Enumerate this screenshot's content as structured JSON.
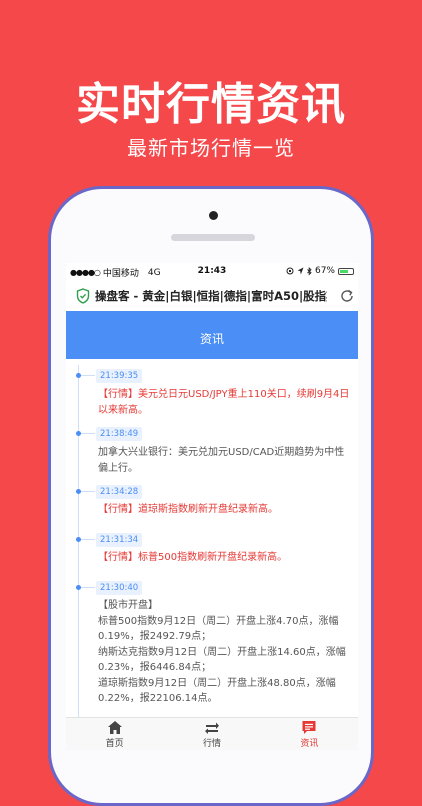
{
  "headline": "实时行情资讯",
  "subhead": "最新市场行情一览",
  "status_bar": {
    "signal": "●●●●○",
    "carrier": "中国移动",
    "network": "4G",
    "time": "21:43",
    "battery_percent": "67%",
    "battery_level": 0.67
  },
  "url_bar": {
    "title": "操盘客 - 黄金|白银|恒指|德指|富时A50|股指期..."
  },
  "banner": {
    "title": "资讯"
  },
  "feed": [
    {
      "time": "21:39:35",
      "text": "【行情】美元兑日元USD/JPY重上110关口，续刷9月4日以来新高。",
      "highlight": true
    },
    {
      "time": "21:38:49",
      "text": "加拿大兴业银行：美元兑加元USD/CAD近期趋势为中性偏上行。",
      "highlight": false
    },
    {
      "time": "21:34:28",
      "text": "【行情】道琼斯指数刷新开盘纪录新高。",
      "highlight": true
    },
    {
      "time": "21:31:34",
      "text": "【行情】标普500指数刷新开盘纪录新高。",
      "highlight": true
    },
    {
      "time": "21:30:40",
      "text": "【股市开盘】\n标普500指数9月12日（周二）开盘上涨4.70点，涨幅0.19%，报2492.79点；\n纳斯达克指数9月12日（周二）开盘上涨14.60点，涨幅0.23%，报6446.84点；\n道琼斯指数9月12日（周二）开盘上涨48.80点，涨幅0.22%，报22106.14点。",
      "highlight": false
    }
  ],
  "tabs": [
    {
      "label": "首页",
      "icon": "home-icon",
      "active": false
    },
    {
      "label": "行情",
      "icon": "swap-icon",
      "active": false
    },
    {
      "label": "资讯",
      "icon": "message-icon",
      "active": true
    }
  ],
  "colors": {
    "background": "#f5484b",
    "banner": "#4b8ef6",
    "highlight_text": "#e53935",
    "frame": "#6b67c8"
  }
}
